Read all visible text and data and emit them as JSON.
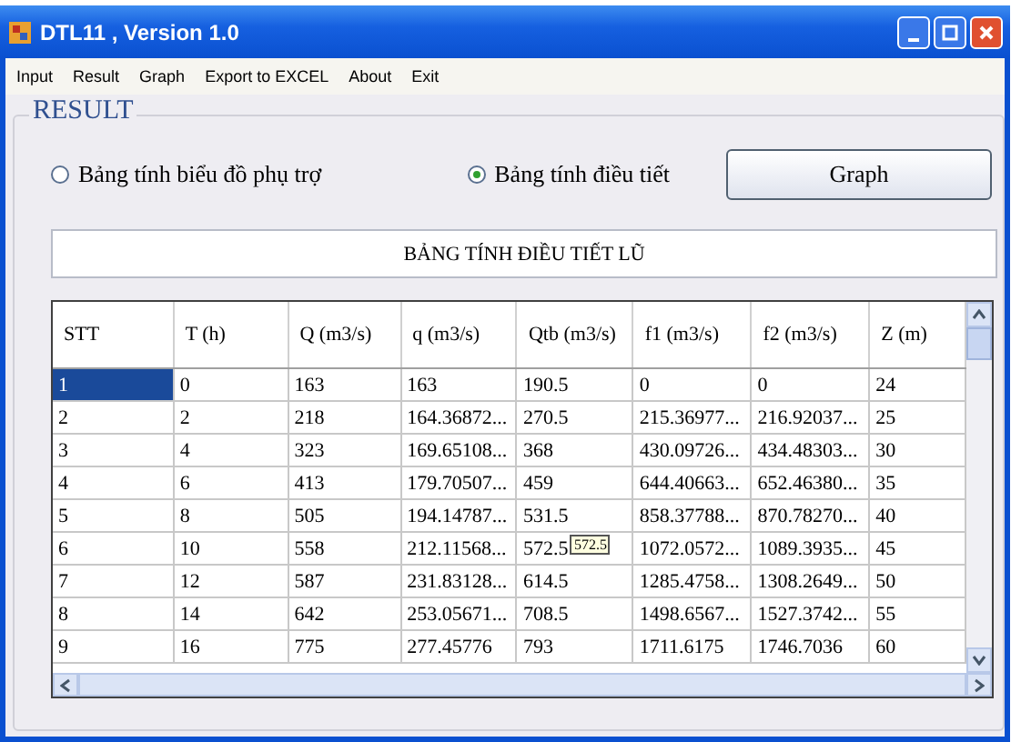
{
  "window": {
    "title": "DTL11 , Version 1.0"
  },
  "menu": [
    "Input",
    "Result",
    "Graph",
    "Export to EXCEL",
    "About",
    "Exit"
  ],
  "group": {
    "title": "RESULT"
  },
  "radios": [
    {
      "label": "Bảng tính biểu đồ phụ trợ",
      "selected": false
    },
    {
      "label": "Bảng tính điều tiết",
      "selected": true
    }
  ],
  "graph_button": "Graph",
  "table_title": "BẢNG TÍNH ĐIỀU TIẾT LŨ",
  "table": {
    "columns": [
      "STT",
      "T (h)",
      "Q (m3/s)",
      "q (m3/s)",
      "Qtb (m3/s)",
      "f1 (m3/s)",
      "f2 (m3/s)",
      "Z (m)"
    ],
    "rows": [
      {
        "cells": [
          "1",
          "0",
          "163",
          "163",
          "190.5",
          "0",
          "0",
          "24"
        ],
        "selected": true
      },
      {
        "cells": [
          "2",
          "2",
          "218",
          "164.36872...",
          "270.5",
          "215.36977...",
          "216.92037...",
          "25"
        ],
        "selected": false
      },
      {
        "cells": [
          "3",
          "4",
          "323",
          "169.65108...",
          "368",
          "430.09726...",
          "434.48303...",
          "30"
        ],
        "selected": false
      },
      {
        "cells": [
          "4",
          "6",
          "413",
          "179.70507...",
          "459",
          "644.40663...",
          "652.46380...",
          "35"
        ],
        "selected": false
      },
      {
        "cells": [
          "5",
          "8",
          "505",
          "194.14787...",
          "531.5",
          "858.37788...",
          "870.78270...",
          "40"
        ],
        "selected": false
      },
      {
        "cells": [
          "6",
          "10",
          "558",
          "212.11568...",
          "572.5",
          "1072.0572...",
          "1089.3935...",
          "45"
        ],
        "selected": false,
        "tooltip": "572.5"
      },
      {
        "cells": [
          "7",
          "12",
          "587",
          "231.83128...",
          "614.5",
          "1285.4758...",
          "1308.2649...",
          "50"
        ],
        "selected": false
      },
      {
        "cells": [
          "8",
          "14",
          "642",
          "253.05671...",
          "708.5",
          "1498.6567...",
          "1527.3742...",
          "55"
        ],
        "selected": false
      },
      {
        "cells": [
          "9",
          "16",
          "775",
          "277.45776",
          "793",
          "1711.6175",
          "1746.7036",
          "60"
        ],
        "selected": false
      }
    ]
  }
}
